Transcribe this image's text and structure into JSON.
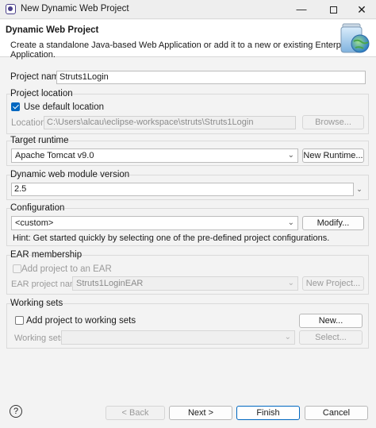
{
  "window": {
    "title": "New Dynamic Web Project"
  },
  "banner": {
    "title": "Dynamic Web Project",
    "description": "Create a standalone Java-based Web Application or add it to a new or existing Enterprise Application."
  },
  "project_name": {
    "label": "Project name:",
    "value": "Struts1Login"
  },
  "project_location": {
    "group_label": "Project location",
    "use_default_label": "Use default location",
    "use_default_checked": true,
    "location_label": "Location:",
    "location_value": "C:\\Users\\alcau\\eclipse-workspace\\struts\\Struts1Login",
    "browse_label": "Browse..."
  },
  "target_runtime": {
    "group_label": "Target runtime",
    "selected": "Apache Tomcat v9.0",
    "new_runtime_label": "New Runtime..."
  },
  "module_version": {
    "group_label": "Dynamic web module version",
    "selected": "2.5"
  },
  "configuration": {
    "group_label": "Configuration",
    "selected": "<custom>",
    "modify_label": "Modify...",
    "hint": "Hint: Get started quickly by selecting one of the pre-defined project configurations."
  },
  "ear_membership": {
    "group_label": "EAR membership",
    "add_label": "Add project to an EAR",
    "ear_name_label": "EAR project name:",
    "ear_name_value": "Struts1LoginEAR",
    "new_project_label": "New Project..."
  },
  "working_sets": {
    "group_label": "Working sets",
    "add_label": "Add project to working sets",
    "new_label": "New...",
    "sets_label": "Working sets:",
    "select_label": "Select..."
  },
  "footer": {
    "help_glyph": "?",
    "back_label": "< Back",
    "next_label": "Next >",
    "finish_label": "Finish",
    "cancel_label": "Cancel"
  },
  "colors": {
    "accent": "#0067c0",
    "disabled_text": "#9a9a9a"
  }
}
